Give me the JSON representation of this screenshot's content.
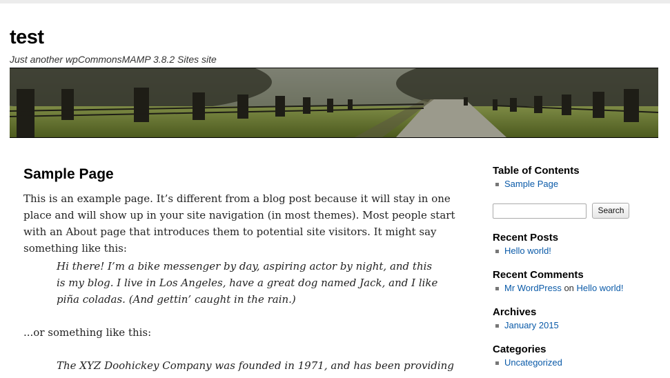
{
  "site": {
    "title": "test",
    "description": "Just another wpCommonsMAMP 3.8.2 Sites site"
  },
  "page": {
    "title": "Sample Page",
    "paragraph1": "This is an example page. It’s different from a blog post because it will stay in one place and will show up in your site navigation (in most themes). Most people start with an About page that introduces them to potential site visitors. It might say something like this:",
    "quote1": "Hi there! I’m a bike messenger by day, aspiring actor by night, and this is my blog. I live in Los Angeles, have a great dog named Jack, and I like piña coladas. (And gettin’ caught in the rain.)",
    "paragraph2": "...or something like this:",
    "quote2": "The XYZ Doohickey Company was founded in 1971, and has been providing"
  },
  "sidebar": {
    "toc": {
      "title": "Table of Contents",
      "items": [
        "Sample Page"
      ]
    },
    "search": {
      "button_label": "Search",
      "value": "",
      "placeholder": ""
    },
    "recent_posts": {
      "title": "Recent Posts",
      "items": [
        "Hello world!"
      ]
    },
    "recent_comments": {
      "title": "Recent Comments",
      "author": "Mr WordPress",
      "connector": "on",
      "post": "Hello world!"
    },
    "archives": {
      "title": "Archives",
      "items": [
        "January 2015"
      ]
    },
    "categories": {
      "title": "Categories",
      "items": [
        "Uncategorized"
      ]
    }
  },
  "colors": {
    "link": "#0a5aa8",
    "title": "#000000",
    "bullet": "#777777"
  },
  "icons": {
    "banner": "tree-lined-path-image"
  }
}
